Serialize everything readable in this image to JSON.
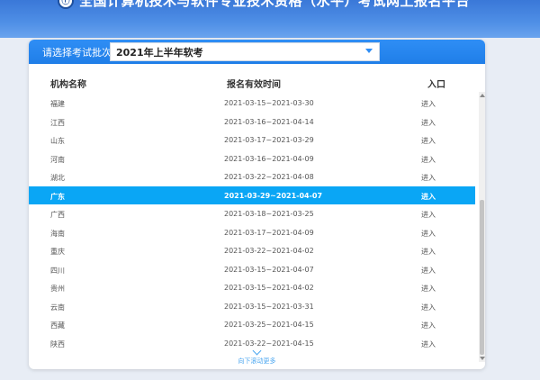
{
  "banner": {
    "logo_text": "ⓡ",
    "title": "全国计算机技术与软件专业技术资格（水平）考试网上报名平台"
  },
  "selector": {
    "label": "请选择考试批次:",
    "value": "2021年上半年软考"
  },
  "table": {
    "headers": [
      "机构名称",
      "报名有效时间",
      "入口"
    ],
    "rows": [
      {
        "org": "福建",
        "time": "2021-03-15~2021-03-30",
        "entry": "进入"
      },
      {
        "org": "江西",
        "time": "2021-03-16~2021-04-14",
        "entry": "进入"
      },
      {
        "org": "山东",
        "time": "2021-03-17~2021-03-29",
        "entry": "进入"
      },
      {
        "org": "河南",
        "time": "2021-03-16~2021-04-09",
        "entry": "进入"
      },
      {
        "org": "湖北",
        "time": "2021-03-22~2021-04-08",
        "entry": "进入"
      },
      {
        "org": "广东",
        "time": "2021-03-29~2021-04-07",
        "entry": "进入"
      },
      {
        "org": "广西",
        "time": "2021-03-18~2021-03-25",
        "entry": "进入"
      },
      {
        "org": "海南",
        "time": "2021-03-17~2021-04-09",
        "entry": "进入"
      },
      {
        "org": "重庆",
        "time": "2021-03-22~2021-04-02",
        "entry": "进入"
      },
      {
        "org": "四川",
        "time": "2021-03-15~2021-04-07",
        "entry": "进入"
      },
      {
        "org": "贵州",
        "time": "2021-03-15~2021-04-02",
        "entry": "进入"
      },
      {
        "org": "云南",
        "time": "2021-03-15~2021-03-31",
        "entry": "进入"
      },
      {
        "org": "西藏",
        "time": "2021-03-25~2021-04-15",
        "entry": "进入"
      },
      {
        "org": "陕西",
        "time": "2021-03-22~2021-04-15",
        "entry": "进入"
      }
    ],
    "selected_org": "广东"
  },
  "more": {
    "label": "向下滚动更多"
  }
}
